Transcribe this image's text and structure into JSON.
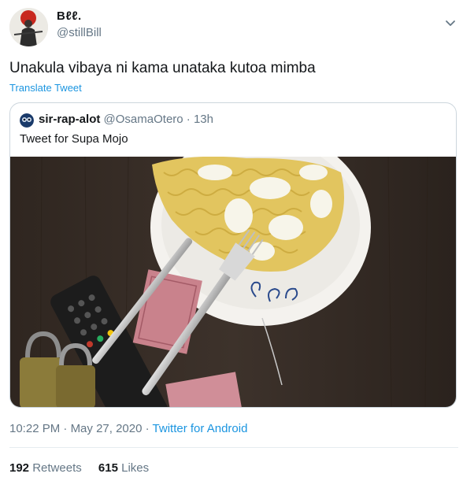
{
  "author": {
    "display_name": "Bℓℓ.",
    "handle": "@stillBill"
  },
  "tweet": {
    "text": "Unakula vibaya ni kama unataka kutoa mimba",
    "translate_label": "Translate Tweet"
  },
  "quoted": {
    "display_name": "sir-rap-alot",
    "handle": "@OsamaOtero",
    "separator": "·",
    "time": "13h",
    "text": "Tweet for Supa Mojo"
  },
  "meta": {
    "time": "10:22 PM",
    "separator1": "·",
    "date": "May 27, 2020",
    "separator2": "·",
    "source": "Twitter for Android"
  },
  "stats": {
    "retweets_count": "192",
    "retweets_label": "Retweets",
    "likes_count": "615",
    "likes_label": "Likes"
  },
  "icons": {
    "more": "chevron-down-icon"
  },
  "colors": {
    "link": "#1b95e0",
    "secondary_text": "#657786",
    "border": "#ccd6dd"
  }
}
